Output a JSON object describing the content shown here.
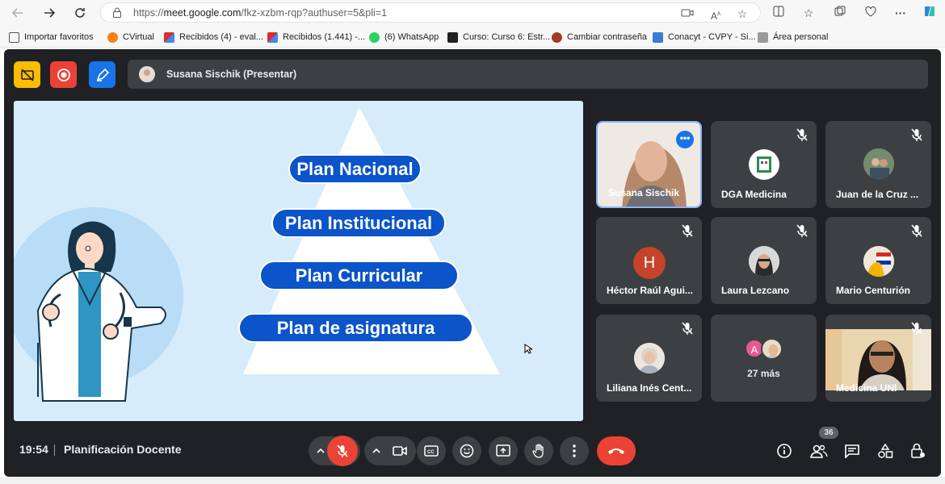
{
  "browser": {
    "url_prefix": "https://",
    "url_host": "meet.google.com",
    "url_path": "/fkz-xzbm-rqp?authuser=5&pli=1"
  },
  "bookmarks": [
    {
      "label": "Importar favoritos",
      "icon": "import-icon",
      "color": "#555555"
    },
    {
      "label": "CVirtual",
      "icon": "moodle-icon",
      "color": "#f98012"
    },
    {
      "label": "Recibidos (4) - eval...",
      "icon": "gmail-icon",
      "color": "#d93025"
    },
    {
      "label": "Recibidos (1.441) -...",
      "icon": "gmail-icon",
      "color": "#d93025"
    },
    {
      "label": "(6) WhatsApp",
      "icon": "whatsapp-icon",
      "color": "#25d366"
    },
    {
      "label": "Curso: Curso 6: Estr...",
      "icon": "course-icon",
      "color": "#222222"
    },
    {
      "label": "Cambiar contraseña",
      "icon": "una-icon",
      "color": "#a33a2a"
    },
    {
      "label": "Conacyt - CVPY - Si...",
      "icon": "conacyt-icon",
      "color": "#3a7bd5"
    },
    {
      "label": "Área personal",
      "icon": "personal-icon",
      "color": "#777777"
    }
  ],
  "meet": {
    "presenter_label": "Susana Sischik (Presentar)",
    "slide": {
      "levels": [
        "Plan Nacional",
        "Plan Institucional",
        "Plan Curricular",
        "Plan de asignatura"
      ]
    },
    "participants": [
      {
        "name": "Susana Sischik",
        "type": "video",
        "speaking": true
      },
      {
        "name": "DGA Medicina",
        "type": "avatar",
        "muted": true
      },
      {
        "name": "Juan de la Cruz ...",
        "type": "avatar",
        "muted": true
      },
      {
        "name": "Héctor Raúl Agui...",
        "type": "initial",
        "initial": "H",
        "color": "#c5432a",
        "muted": true
      },
      {
        "name": "Laura Lezcano",
        "type": "avatar",
        "muted": true
      },
      {
        "name": "Mario Centurión",
        "type": "avatar",
        "muted": true
      },
      {
        "name": "Liliana Inés Cent...",
        "type": "avatar",
        "muted": true
      },
      {
        "name": "27 más",
        "type": "more",
        "initial": "A"
      },
      {
        "name": "Medicina UNI",
        "type": "video",
        "muted": true
      }
    ],
    "bottom": {
      "time": "19:54",
      "meeting_title": "Planificación Docente",
      "participant_count": "36"
    },
    "colors": {
      "accent": "#0b54c9",
      "hangup": "#ea4335",
      "bg": "#202124",
      "tile": "#3c4043"
    }
  }
}
